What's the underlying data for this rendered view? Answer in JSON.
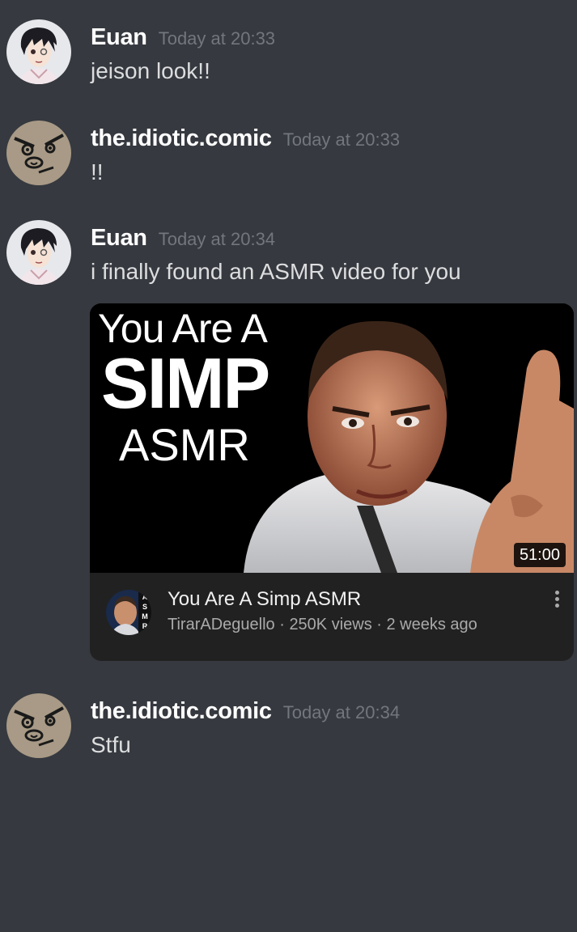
{
  "messages": [
    {
      "username": "Euan",
      "timestamp": "Today at 20:33",
      "text": "jeison look!!",
      "avatar_icon": "anime-boy-avatar-icon"
    },
    {
      "username": "the.idiotic.comic",
      "timestamp": "Today at 20:33",
      "text": "!!",
      "avatar_icon": "angry-face-avatar-icon"
    },
    {
      "username": "Euan",
      "timestamp": "Today at 20:34",
      "text": "i finally found an ASMR video for you",
      "avatar_icon": "anime-boy-avatar-icon"
    },
    {
      "username": "the.idiotic.comic",
      "timestamp": "Today at 20:34",
      "text": "Stfu",
      "avatar_icon": "angry-face-avatar-icon"
    }
  ],
  "embed": {
    "thumbnail_line1": "You Are A",
    "thumbnail_line2": "SIMP",
    "thumbnail_line3": "ASMR",
    "duration": "51:00",
    "video_title": "You Are A Simp ASMR",
    "channel": "TirarADeguello",
    "views": "250K views",
    "age": "2 weeks ago",
    "meta_separator": " · ",
    "channel_badge": "ASMR",
    "more_icon": "more-vertical-icon"
  },
  "colors": {
    "background": "#36393f",
    "username": "#ffffff",
    "timestamp": "#72767d",
    "message_text": "#dcddde",
    "embed_bg": "#212121"
  }
}
